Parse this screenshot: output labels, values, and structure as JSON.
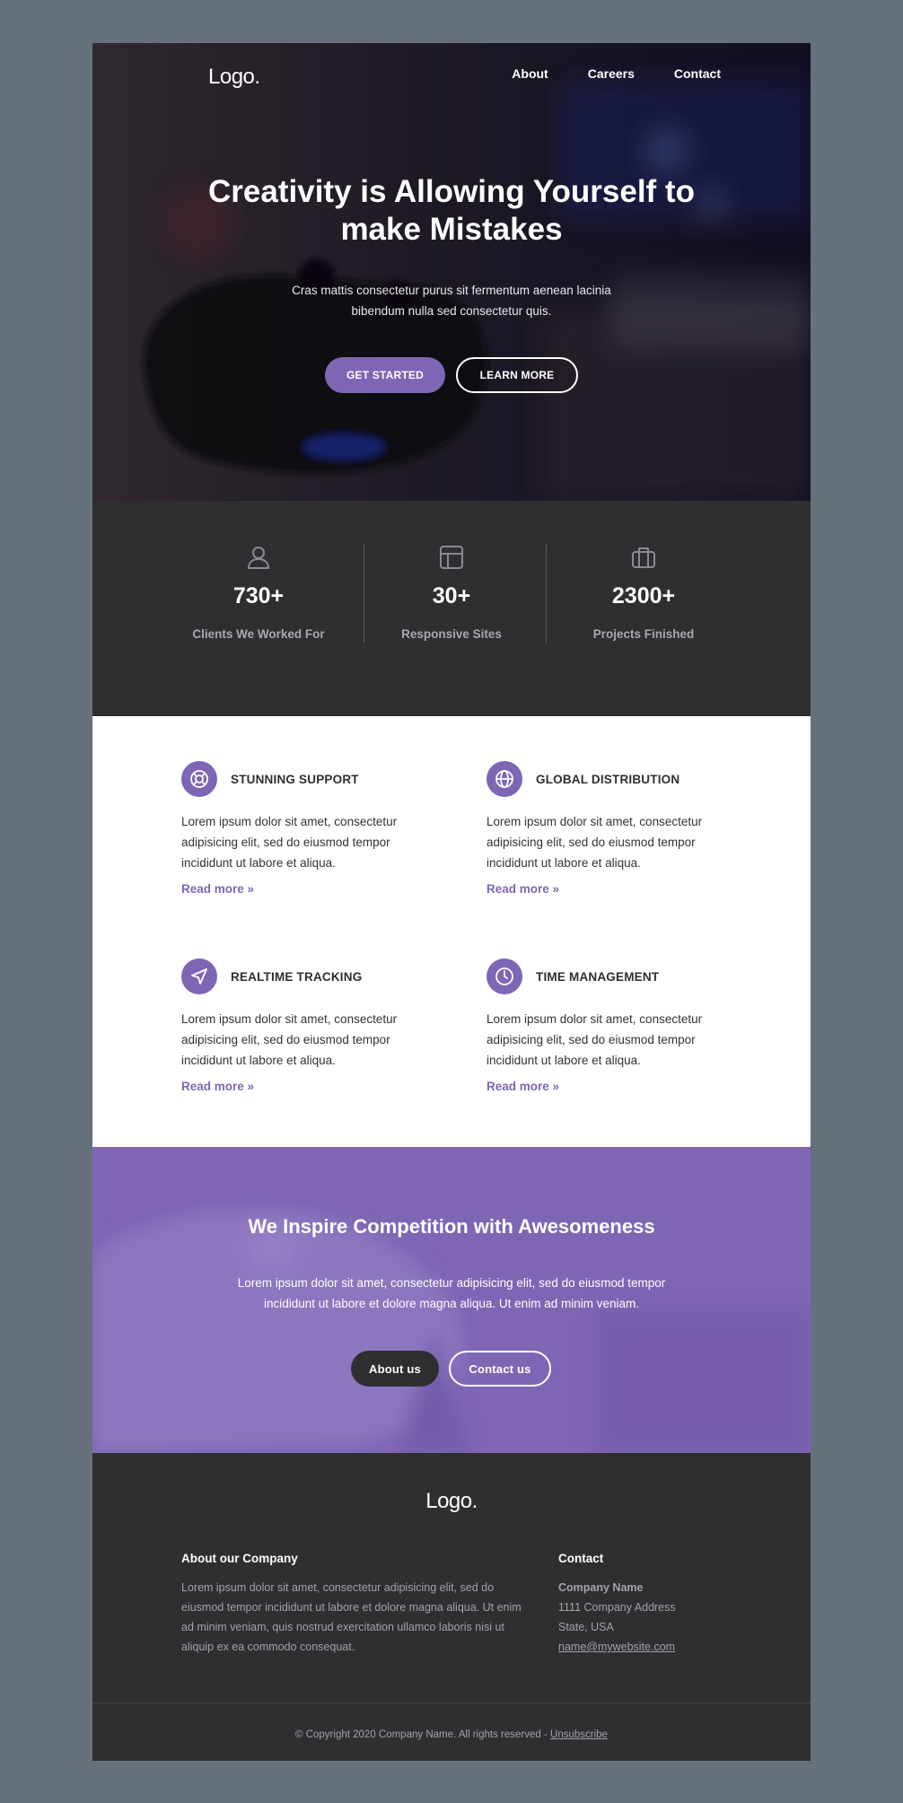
{
  "header": {
    "logo": "Logo.",
    "nav": [
      "About",
      "Careers",
      "Contact"
    ]
  },
  "hero": {
    "title": "Creativity is Allowing Yourself to make Mistakes",
    "subtitle": "Cras mattis consectetur purus sit fermentum aenean lacinia bibendum nulla sed consectetur quis.",
    "primary_button": "GET STARTED",
    "secondary_button": "LEARN MORE"
  },
  "stats": [
    {
      "icon": "user-icon",
      "value": "730+",
      "label": "Clients We Worked For"
    },
    {
      "icon": "layout-icon",
      "value": "30+",
      "label": "Responsive Sites"
    },
    {
      "icon": "briefcase-icon",
      "value": "2300+",
      "label": "Projects Finished"
    }
  ],
  "features": [
    {
      "icon": "lifebuoy-icon",
      "title": "STUNNING SUPPORT",
      "text": "Lorem ipsum dolor sit amet, consectetur adipisicing elit, sed do eiusmod tempor incididunt ut labore et aliqua.",
      "link": "Read more »"
    },
    {
      "icon": "globe-icon",
      "title": "GLOBAL DISTRIBUTION",
      "text": "Lorem ipsum dolor sit amet, consectetur adipisicing elit, sed do eiusmod tempor incididunt ut labore et aliqua.",
      "link": "Read more »"
    },
    {
      "icon": "navigation-icon",
      "title": "REALTIME TRACKING",
      "text": "Lorem ipsum dolor sit amet, consectetur adipisicing elit, sed do eiusmod tempor incididunt ut labore et aliqua.",
      "link": "Read more »"
    },
    {
      "icon": "clock-icon",
      "title": "TIME MANAGEMENT",
      "text": "Lorem ipsum dolor sit amet, consectetur adipisicing elit, sed do eiusmod tempor incididunt ut labore et aliqua.",
      "link": "Read more »"
    }
  ],
  "cta": {
    "title": "We Inspire Competition with Awesomeness",
    "text": "Lorem ipsum dolor sit amet, consectetur adipisicing elit, sed do eiusmod tempor incididunt ut labore et dolore magna aliqua. Ut enim ad minim veniam.",
    "primary_button": "About us",
    "secondary_button": "Contact us"
  },
  "footer": {
    "logo": "Logo.",
    "about_title": "About our Company",
    "about_text": "Lorem ipsum dolor sit amet, consectetur adipisicing elit, sed do eiusmod tempor incididunt ut labore et dolore magna aliqua. Ut enim ad minim veniam, quis nostrud exercitation ullamco laboris nisi ut aliquip ex ea commodo consequat.",
    "contact_title": "Contact",
    "company_name": "Company Name",
    "address": "1111 Company Address",
    "state": "State, USA",
    "email": "name@mywebsite.com",
    "copyright": "© Copyright 2020 Company Name. All rights reserved  -",
    "unsubscribe": "Unsubscribe"
  },
  "colors": {
    "accent": "#7e66b4",
    "dark": "#2f2f32",
    "page_bg": "#67717c"
  }
}
